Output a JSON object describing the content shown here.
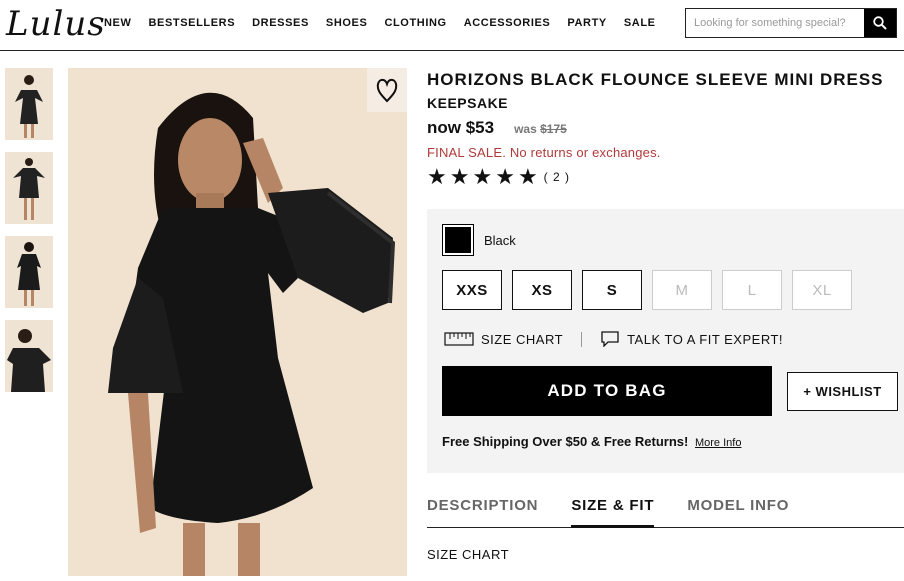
{
  "header": {
    "logo": "Lulus",
    "nav": [
      "NEW",
      "BESTSELLERS",
      "DRESSES",
      "SHOES",
      "CLOTHING",
      "ACCESSORIES",
      "PARTY",
      "SALE"
    ],
    "search_placeholder": "Looking for something special?"
  },
  "product": {
    "title": "HORIZONS BLACK FLOUNCE SLEEVE MINI DRESS",
    "brand": "KEEPSAKE",
    "price_now": "now $53",
    "price_was_label": "was",
    "price_was_amount": "$175",
    "final_sale": "FINAL SALE. No returns or exchanges.",
    "rating_stars": 5,
    "rating_count": "( 2 )"
  },
  "options": {
    "color_name": "Black",
    "color_hex": "#000000",
    "sizes": [
      {
        "label": "XXS",
        "available": true
      },
      {
        "label": "XS",
        "available": true
      },
      {
        "label": "S",
        "available": true
      },
      {
        "label": "M",
        "available": false
      },
      {
        "label": "L",
        "available": false
      },
      {
        "label": "XL",
        "available": false
      }
    ],
    "size_chart_link": "SIZE CHART",
    "fit_expert_link": "TALK TO A FIT EXPERT!",
    "add_to_bag": "ADD TO BAG",
    "wishlist": "+ WISHLIST",
    "shipping_text": "Free Shipping Over $50 & Free Returns!",
    "more_info": "More Info"
  },
  "tabs": [
    {
      "label": "DESCRIPTION",
      "active": false
    },
    {
      "label": "SIZE & FIT",
      "active": true
    },
    {
      "label": "MODEL INFO",
      "active": false
    }
  ],
  "tab_content": {
    "heading": "SIZE CHART"
  },
  "colors": {
    "final_sale": "#b03a3a",
    "image_background": "#f1e2cf",
    "options_background": "#f3f3f3"
  }
}
